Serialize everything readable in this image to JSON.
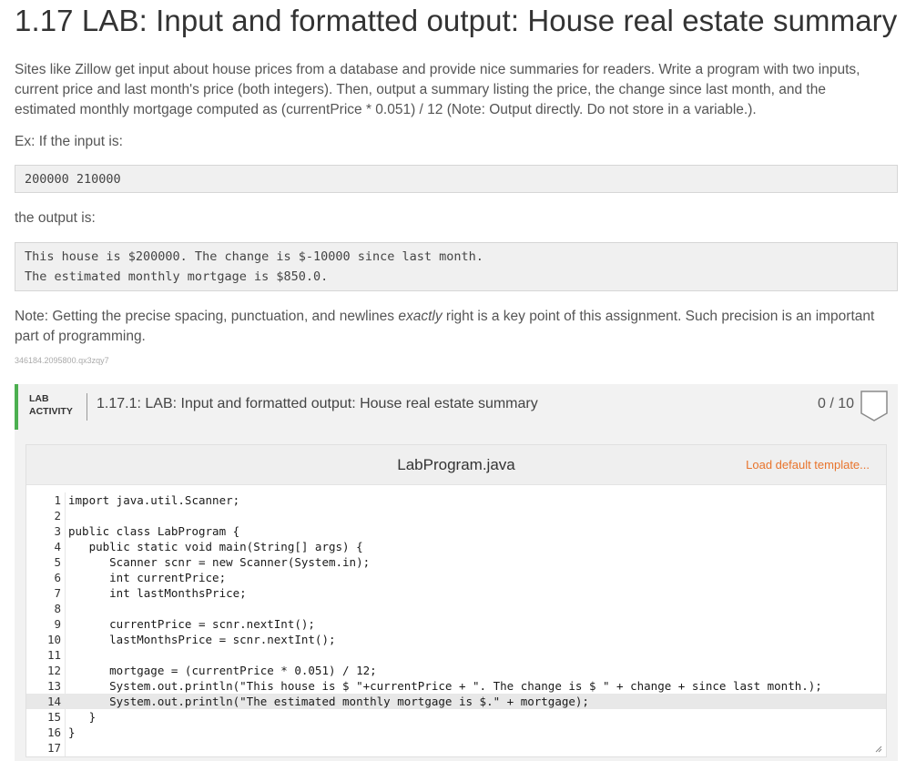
{
  "title": "1.17 LAB: Input and formatted output: House real estate summary",
  "intro": "Sites like Zillow get input about house prices from a database and provide nice summaries for readers. Write a program with two inputs, current price and last month's price (both integers). Then, output a summary listing the price, the change since last month, and the estimated monthly mortgage computed as (currentPrice * 0.051) / 12 (Note: Output directly. Do not store in a variable.).",
  "example_label": "Ex: If the input is:",
  "example_input": [
    "200000 210000"
  ],
  "output_label": "the output is:",
  "example_output": [
    "This house is $200000. The change is $-10000 since last month.",
    "The estimated monthly mortgage is $850.0."
  ],
  "note_before": "Note: Getting the precise spacing, punctuation, and newlines ",
  "note_em": "exactly",
  "note_after": " right is a key point of this assignment. Such precision is an important part of programming.",
  "meta_id": "346184.2095800.qx3zqy7",
  "lab": {
    "tag_line1": "LAB",
    "tag_line2": "ACTIVITY",
    "title": "1.17.1: LAB: Input and formatted output: House real estate summary",
    "score": "0 / 10"
  },
  "editor": {
    "filename": "LabProgram.java",
    "load_label": "Load default template...",
    "active_line": 14,
    "lines": [
      {
        "n": "1",
        "code": "import java.util.Scanner;"
      },
      {
        "n": "2",
        "code": ""
      },
      {
        "n": "3",
        "code": "public class LabProgram {"
      },
      {
        "n": "4",
        "code": "   public static void main(String[] args) {"
      },
      {
        "n": "5",
        "code": "      Scanner scnr = new Scanner(System.in);"
      },
      {
        "n": "6",
        "code": "      int currentPrice;"
      },
      {
        "n": "7",
        "code": "      int lastMonthsPrice;"
      },
      {
        "n": "8",
        "code": ""
      },
      {
        "n": "9",
        "code": "      currentPrice = scnr.nextInt();"
      },
      {
        "n": "10",
        "code": "      lastMonthsPrice = scnr.nextInt();"
      },
      {
        "n": "11",
        "code": ""
      },
      {
        "n": "12",
        "code": "      mortgage = (currentPrice * 0.051) / 12;"
      },
      {
        "n": "13",
        "code": "      System.out.println(\"This house is $ \"+currentPrice + \". The change is $ \" + change + since last month.);"
      },
      {
        "n": "14",
        "code": "      System.out.println(\"The estimated monthly mortgage is $.\" + mortgage);"
      },
      {
        "n": "15",
        "code": "   }"
      },
      {
        "n": "16",
        "code": "}"
      },
      {
        "n": "17",
        "code": ""
      }
    ]
  },
  "colors": {
    "accent_green": "#4caf50",
    "link_orange": "#e8742c"
  },
  "icons": {
    "score_badge": "shield-icon",
    "resize_handle": "resize-icon"
  }
}
